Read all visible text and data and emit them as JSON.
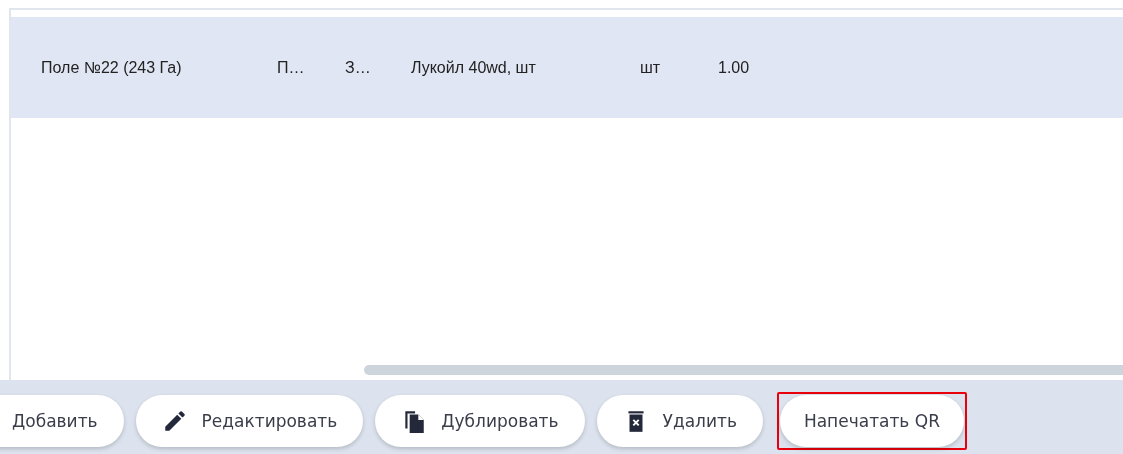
{
  "table": {
    "rows": [
      {
        "selected": true,
        "cells": [
          "Поле №22 (243 Га)",
          "П…",
          "З…",
          "Лукойл 40wd, шт",
          "шт",
          "1.00"
        ]
      }
    ]
  },
  "toolbar": {
    "buttons": [
      {
        "label": "Добавить",
        "kind": "plain",
        "highlighted": false
      },
      {
        "label": "Редактировать",
        "kind": "edit",
        "highlighted": false
      },
      {
        "label": "Дублировать",
        "kind": "duplicate",
        "highlighted": false
      },
      {
        "label": "Удалить",
        "kind": "delete",
        "highlighted": false
      },
      {
        "label": "Напечатать QR",
        "kind": "plain",
        "highlighted": true
      }
    ]
  }
}
